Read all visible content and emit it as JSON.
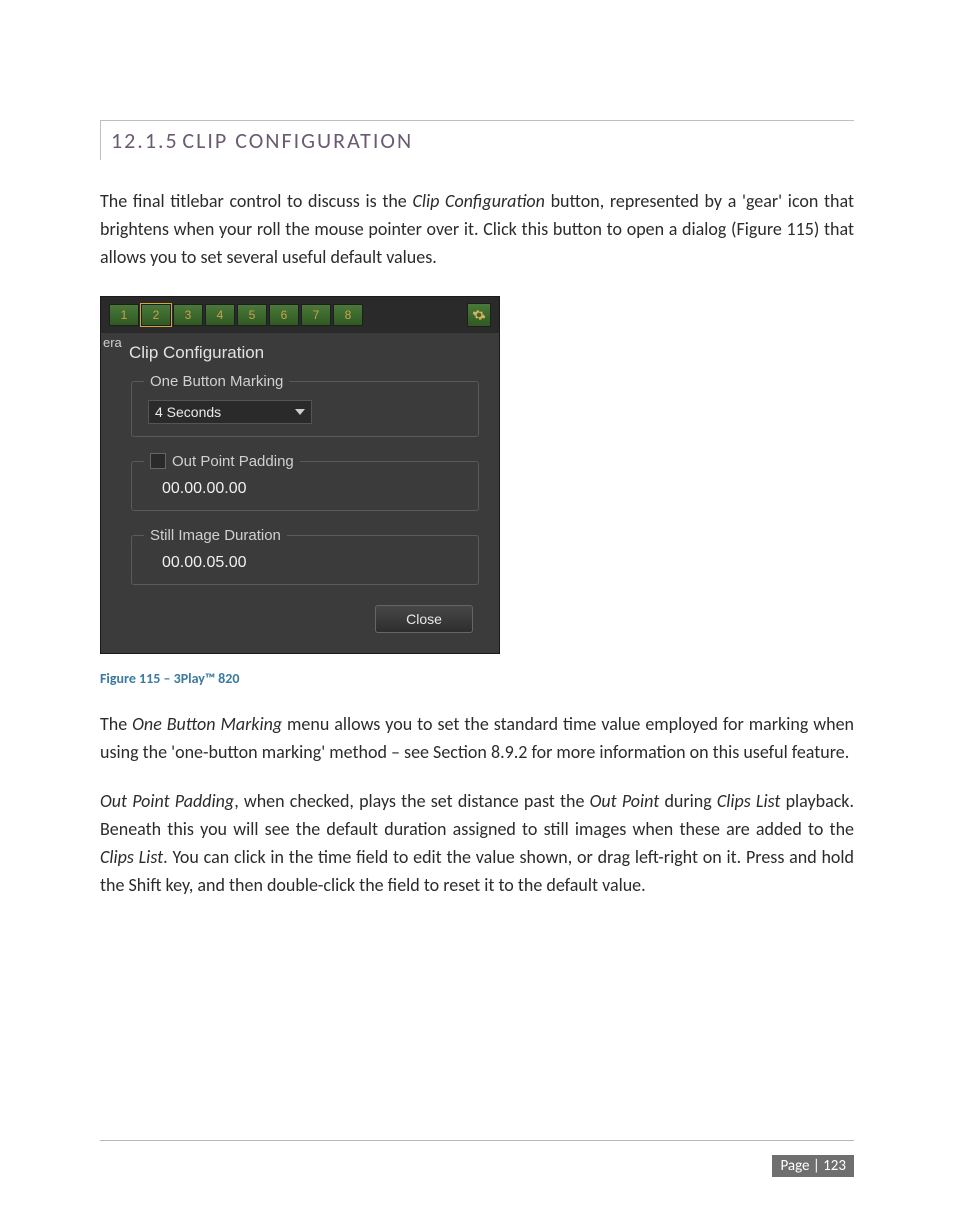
{
  "section": {
    "number": "12.1.5",
    "title": "CLIP CONFIGURATION"
  },
  "paragraphs": {
    "p1_a": "The final titlebar control to discuss is the ",
    "p1_em1": "Clip Configuration",
    "p1_b": " button, represented by a 'gear' icon that brightens when your roll the mouse pointer over it.  Click this button to open a dialog (Figure 115) that allows you to set several useful default values.",
    "p2_a": "The ",
    "p2_em1": "One Button Marking",
    "p2_b": " menu allows you to set the standard time value employed for marking when using the 'one-button marking' method – see Section 8.9.2 for more information on this useful feature.",
    "p3_em1": "Out Point Padding",
    "p3_a": ", when checked, plays the set distance past the ",
    "p3_em2": "Out Point",
    "p3_b": " during ",
    "p3_em3": "Clips List",
    "p3_c": " playback. Beneath this you will see the default duration assigned to still images when these are added to the ",
    "p3_em4": "Clips List",
    "p3_d": ".  You can click in the time field to edit the value shown, or drag left-right on it.  Press and hold the Shift key, and then double-click the field to reset it to the default value."
  },
  "figure_caption": "Figure 115 – 3Play™ 820",
  "screenshot": {
    "tabs": [
      "1",
      "2",
      "3",
      "4",
      "5",
      "6",
      "7",
      "8"
    ],
    "gear_icon": "gear-icon",
    "era_label": "era",
    "dialog_title": "Clip Configuration",
    "one_button_marking": {
      "legend": "One Button Marking",
      "value": "4 Seconds"
    },
    "out_point_padding": {
      "legend": "Out Point Padding",
      "value": "00.00.00.00",
      "checked": false
    },
    "still_image_duration": {
      "legend": "Still Image Duration",
      "value": "00.00.05.00"
    },
    "close_label": "Close"
  },
  "footer": {
    "page_label": "Page | 123"
  }
}
